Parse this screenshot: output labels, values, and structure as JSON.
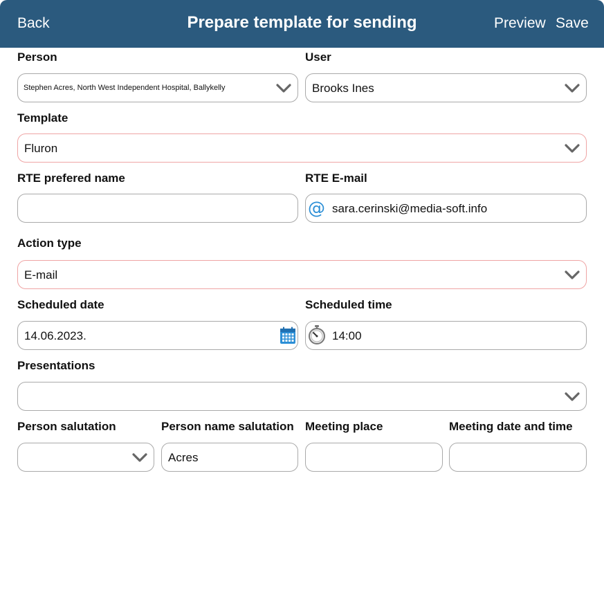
{
  "header": {
    "back_label": "Back",
    "title": "Prepare template for sending",
    "preview_label": "Preview",
    "save_label": "Save",
    "background_color": "#2b5a7e"
  },
  "form": {
    "person": {
      "label": "Person",
      "value": "Stephen Acres, North West Independent Hospital, Ballykelly"
    },
    "user": {
      "label": "User",
      "value": "Brooks Ines"
    },
    "template": {
      "label": "Template",
      "value": "Fluron"
    },
    "rte_preferred_name": {
      "label": "RTE prefered name",
      "value": ""
    },
    "rte_email": {
      "label": "RTE E-mail",
      "value": "sara.cerinski@media-soft.info",
      "icon": "at-icon"
    },
    "action_type": {
      "label": "Action type",
      "value": "E-mail"
    },
    "scheduled_date": {
      "label": "Scheduled date",
      "value": "14.06.2023.",
      "icon": "calendar-icon"
    },
    "scheduled_time": {
      "label": "Scheduled time",
      "value": "14:00",
      "icon": "stopwatch-icon"
    },
    "presentations": {
      "label": "Presentations",
      "value": ""
    },
    "person_salutation": {
      "label": "Person salutation",
      "value": ""
    },
    "person_name_salutation": {
      "label": "Person name salutation",
      "value": "Acres"
    },
    "meeting_place": {
      "label": "Meeting place",
      "value": ""
    },
    "meeting_date_time": {
      "label": "Meeting date and time",
      "value": ""
    }
  },
  "colors": {
    "required_border": "#efa4a4",
    "default_border": "#a9a9a9",
    "accent_blue": "#2c8fd6"
  }
}
